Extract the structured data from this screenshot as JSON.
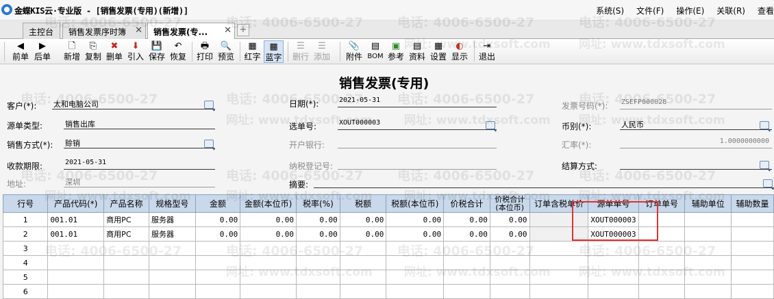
{
  "titlebar": {
    "title": "金蝶KIS云·专业版 - [销售发票(专用)(新增)]",
    "menus": [
      "系统(S)",
      "文件(F)",
      "操作(E)",
      "关联(R)",
      "查看"
    ]
  },
  "tabs": [
    {
      "label": "主控台",
      "closable": false,
      "active": false
    },
    {
      "label": "销售发票序时簿",
      "closable": true,
      "active": false
    },
    {
      "label": "销售发票(专...",
      "closable": true,
      "active": true
    }
  ],
  "toolbar": [
    {
      "id": "prev",
      "label": "前单",
      "icon": "◀",
      "icon_name": "prev-arrow-icon"
    },
    {
      "id": "next",
      "label": "后单",
      "icon": "▶",
      "icon_name": "next-arrow-icon"
    },
    {
      "id": "new",
      "label": "新增",
      "icon": "🗋",
      "icon_name": "new-doc-icon"
    },
    {
      "id": "copy",
      "label": "复制",
      "icon": "⎘",
      "icon_name": "copy-icon"
    },
    {
      "id": "delete",
      "label": "删单",
      "icon": "✖",
      "icon_name": "delete-icon"
    },
    {
      "id": "import",
      "label": "引入",
      "icon": "⬇",
      "icon_name": "import-icon"
    },
    {
      "id": "save",
      "label": "保存",
      "icon": "💾",
      "icon_name": "save-icon"
    },
    {
      "id": "restore",
      "label": "恢复",
      "icon": "↶",
      "icon_name": "restore-icon"
    },
    {
      "id": "print",
      "label": "打印",
      "icon": "🖶",
      "icon_name": "print-icon"
    },
    {
      "id": "preview",
      "label": "预览",
      "icon": "🔍",
      "icon_name": "preview-icon"
    },
    {
      "id": "red",
      "label": "红字",
      "icon": "▦",
      "icon_name": "red-invoice-icon"
    },
    {
      "id": "blue",
      "label": "蓝字",
      "icon": "▦",
      "icon_name": "blue-invoice-icon"
    },
    {
      "id": "delrow",
      "label": "删行",
      "icon": "☰",
      "icon_name": "delete-row-icon"
    },
    {
      "id": "addrow",
      "label": "添加",
      "icon": "☰",
      "icon_name": "add-row-icon"
    },
    {
      "id": "attach",
      "label": "附件",
      "icon": "📎",
      "icon_name": "attachment-icon"
    },
    {
      "id": "bom",
      "label": "BOM",
      "icon": "▤",
      "icon_name": "bom-icon"
    },
    {
      "id": "ref",
      "label": "参考",
      "icon": "▣",
      "icon_name": "reference-icon"
    },
    {
      "id": "data",
      "label": "资料",
      "icon": "▤",
      "icon_name": "data-icon"
    },
    {
      "id": "settings",
      "label": "设置",
      "icon": "▦",
      "icon_name": "settings-icon"
    },
    {
      "id": "display",
      "label": "显示",
      "icon": "◐",
      "icon_name": "display-icon"
    },
    {
      "id": "exit",
      "label": "退出",
      "icon": "⇥",
      "icon_name": "exit-icon"
    }
  ],
  "form": {
    "title": "销售发票(专用)",
    "customer": {
      "label": "客户(*):",
      "value": "太和电脑公司"
    },
    "source_type": {
      "label": "源单类型:",
      "value": "销售出库"
    },
    "sales_method": {
      "label": "销售方式(*):",
      "value": "赊销"
    },
    "due_date": {
      "label": "收款期限:",
      "value": "2021-05-31"
    },
    "address": {
      "label": "地址:",
      "value": "深圳"
    },
    "date": {
      "label": "日期(*):",
      "value": "2021-05-31"
    },
    "selected_no": {
      "label": "选单号:",
      "value": "XOUT000003"
    },
    "bank": {
      "label": "开户银行:",
      "value": ""
    },
    "tax_reg_no": {
      "label": "纳税登记号:",
      "value": ""
    },
    "summary": {
      "label": "摘要:",
      "value": ""
    },
    "invoice_no": {
      "label": "发票号码(*):",
      "value": "ZSEFP000028"
    },
    "currency": {
      "label": "币别(*):",
      "value": "人民币"
    },
    "exchange_rate": {
      "label": "汇率(*):",
      "value": "1.0000000000"
    },
    "settlement": {
      "label": "结算方式:",
      "value": ""
    }
  },
  "grid": {
    "columns": [
      "行号",
      "产品代码(*)",
      "产品名称",
      "规格型号",
      "金额",
      "金额(本位币)",
      "税率(%)",
      "税额",
      "税额(本位币)",
      "价税合计",
      "价税合计(本位币)",
      "订单含税单价",
      "源单单号",
      "订单单号",
      "辅助单位",
      "辅助数量"
    ],
    "rows": [
      [
        "1",
        "001.01",
        "商用PC",
        "服务器",
        "0.00",
        "0.00",
        "0.00",
        "0.00",
        "0.00",
        "0.00",
        "0.00",
        "",
        "XOUT000003",
        "",
        "",
        ""
      ],
      [
        "2",
        "001.01",
        "商用PC",
        "服务器",
        "0.00",
        "0.00",
        "0.00",
        "0.00",
        "0.00",
        "0.00",
        "0.00",
        "",
        "XOUT000003",
        "",
        "",
        ""
      ],
      [
        "3",
        "",
        "",
        "",
        "",
        "",
        "",
        "",
        "",
        "",
        "",
        "",
        "",
        "",
        "",
        ""
      ],
      [
        "4",
        "",
        "",
        "",
        "",
        "",
        "",
        "",
        "",
        "",
        "",
        "",
        "",
        "",
        "",
        ""
      ],
      [
        "5",
        "",
        "",
        "",
        "",
        "",
        "",
        "",
        "",
        "",
        "",
        "",
        "",
        "",
        "",
        ""
      ],
      [
        "6",
        "",
        "",
        "",
        "",
        "",
        "",
        "",
        "",
        "",
        "",
        "",
        "",
        "",
        "",
        ""
      ]
    ]
  },
  "watermark": {
    "phone": "电话: 4006-6500-27",
    "url": "网址: www.tdxsoft.com"
  },
  "colors": {
    "grid_header": "#c9d8ea",
    "highlight_box": "#e03030"
  }
}
